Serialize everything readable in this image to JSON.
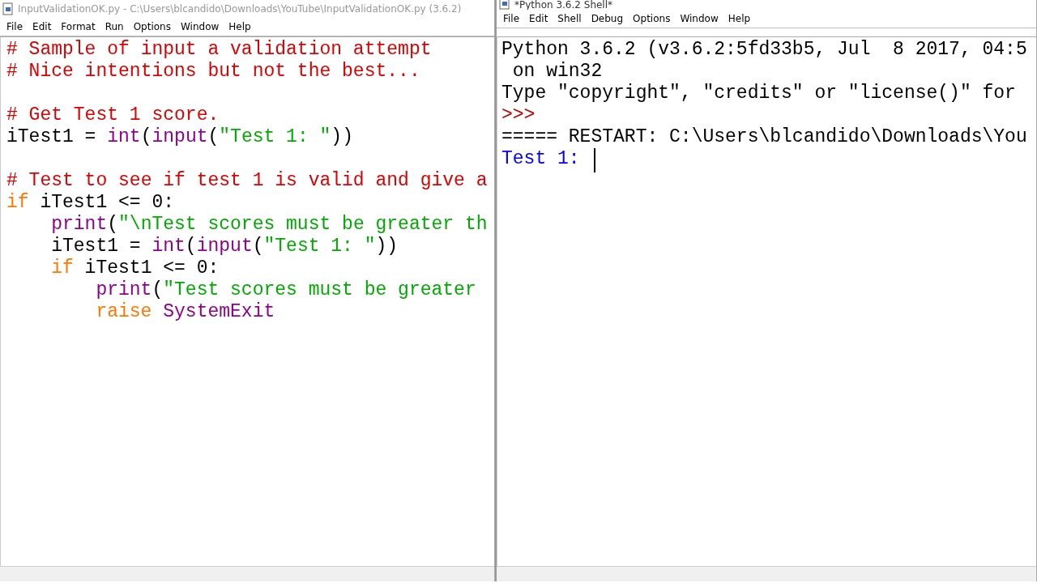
{
  "editor": {
    "title": "InputValidationOK.py - C:\\Users\\blcandido\\Downloads\\YouTube\\InputValidationOK.py (3.6.2)",
    "menu": [
      "File",
      "Edit",
      "Format",
      "Run",
      "Options",
      "Window",
      "Help"
    ],
    "lines": [
      {
        "kind": "code",
        "tokens": [
          {
            "kind": "comment",
            "text": "# Sample of input a validation attempt"
          }
        ]
      },
      {
        "kind": "code",
        "tokens": [
          {
            "kind": "comment",
            "text": "# Nice intentions but not the best..."
          }
        ]
      },
      {
        "kind": "blank"
      },
      {
        "kind": "code",
        "tokens": [
          {
            "kind": "comment",
            "text": "# Get Test 1 score."
          }
        ]
      },
      {
        "kind": "code",
        "tokens": [
          {
            "kind": "plain",
            "text": "iTest1 = "
          },
          {
            "kind": "builtin",
            "text": "int"
          },
          {
            "kind": "plain",
            "text": "("
          },
          {
            "kind": "builtin",
            "text": "input"
          },
          {
            "kind": "plain",
            "text": "("
          },
          {
            "kind": "string",
            "text": "\"Test 1: \""
          },
          {
            "kind": "plain",
            "text": "))"
          }
        ]
      },
      {
        "kind": "blank"
      },
      {
        "kind": "code",
        "tokens": [
          {
            "kind": "comment",
            "text": "# Test to see if test 1 is valid and give a"
          }
        ]
      },
      {
        "kind": "code",
        "tokens": [
          {
            "kind": "keyword",
            "text": "if"
          },
          {
            "kind": "plain",
            "text": " iTest1 <= 0:"
          }
        ],
        "children": [
          {
            "kind": "code",
            "tokens": [
              {
                "kind": "builtin",
                "text": "print"
              },
              {
                "kind": "plain",
                "text": "("
              },
              {
                "kind": "string",
                "text": "\"\\nTest scores must be greater th"
              }
            ]
          },
          {
            "kind": "code",
            "tokens": [
              {
                "kind": "plain",
                "text": "iTest1 = "
              },
              {
                "kind": "builtin",
                "text": "int"
              },
              {
                "kind": "plain",
                "text": "("
              },
              {
                "kind": "builtin",
                "text": "input"
              },
              {
                "kind": "plain",
                "text": "("
              },
              {
                "kind": "string",
                "text": "\"Test 1: \""
              },
              {
                "kind": "plain",
                "text": "))"
              }
            ]
          },
          {
            "kind": "code",
            "tokens": [
              {
                "kind": "keyword",
                "text": "if"
              },
              {
                "kind": "plain",
                "text": " iTest1 <= 0:"
              }
            ],
            "children": [
              {
                "kind": "code",
                "tokens": [
                  {
                    "kind": "builtin",
                    "text": "print"
                  },
                  {
                    "kind": "plain",
                    "text": "("
                  },
                  {
                    "kind": "string",
                    "text": "\"Test scores must be greater"
                  }
                ]
              },
              {
                "kind": "code",
                "tokens": [
                  {
                    "kind": "keyword",
                    "text": "raise "
                  },
                  {
                    "kind": "builtin",
                    "text": "SystemExit"
                  }
                ]
              }
            ]
          }
        ]
      }
    ]
  },
  "shell": {
    "title": "*Python 3.6.2 Shell*",
    "menu": [
      "File",
      "Edit",
      "Shell",
      "Debug",
      "Options",
      "Window",
      "Help"
    ],
    "lines": [
      {
        "kind": "code",
        "tokens": [
          {
            "kind": "plain",
            "text": "Python 3.6.2 (v3.6.2:5fd33b5, Jul  8 2017, 04:5"
          }
        ]
      },
      {
        "kind": "code",
        "tokens": [
          {
            "kind": "plain",
            "text": " on win32"
          }
        ]
      },
      {
        "kind": "code",
        "tokens": [
          {
            "kind": "plain",
            "text": "Type \"copyright\", \"credits\" or \"license()\" for"
          }
        ]
      },
      {
        "kind": "code",
        "tokens": [
          {
            "kind": "prompt",
            "text": ">>>"
          }
        ]
      },
      {
        "kind": "code",
        "tokens": [
          {
            "kind": "plain",
            "text": "===== RESTART: C:\\Users\\blcandido\\Downloads\\You"
          }
        ]
      },
      {
        "kind": "code",
        "tokens": [
          {
            "kind": "stdout",
            "text": "Test 1: "
          },
          {
            "kind": "cursor"
          }
        ]
      }
    ]
  }
}
